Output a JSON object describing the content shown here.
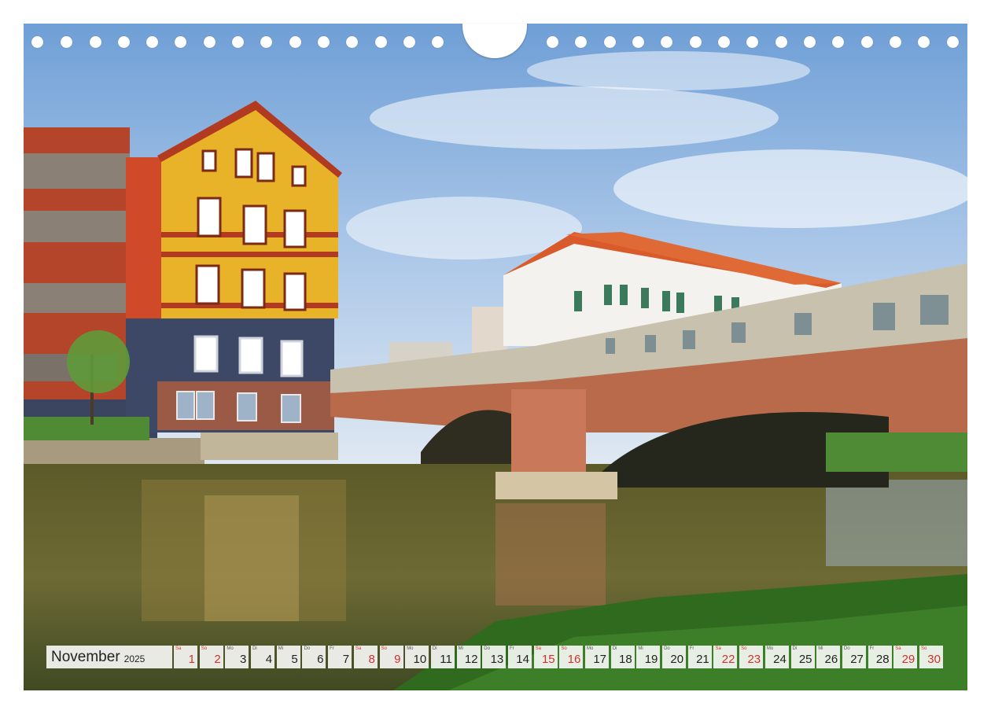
{
  "calendar": {
    "month": "November",
    "year": "2025",
    "days": [
      {
        "n": "1",
        "wd": "Sa",
        "we": true
      },
      {
        "n": "2",
        "wd": "So",
        "we": true
      },
      {
        "n": "3",
        "wd": "Mo",
        "we": false
      },
      {
        "n": "4",
        "wd": "Di",
        "we": false
      },
      {
        "n": "5",
        "wd": "Mi",
        "we": false
      },
      {
        "n": "6",
        "wd": "Do",
        "we": false
      },
      {
        "n": "7",
        "wd": "Fr",
        "we": false
      },
      {
        "n": "8",
        "wd": "Sa",
        "we": true
      },
      {
        "n": "9",
        "wd": "So",
        "we": true
      },
      {
        "n": "10",
        "wd": "Mo",
        "we": false
      },
      {
        "n": "11",
        "wd": "Di",
        "we": false
      },
      {
        "n": "12",
        "wd": "Mi",
        "we": false
      },
      {
        "n": "13",
        "wd": "Do",
        "we": false
      },
      {
        "n": "14",
        "wd": "Fr",
        "we": false
      },
      {
        "n": "15",
        "wd": "Sa",
        "we": true
      },
      {
        "n": "16",
        "wd": "So",
        "we": true
      },
      {
        "n": "17",
        "wd": "Mo",
        "we": false
      },
      {
        "n": "18",
        "wd": "Di",
        "we": false
      },
      {
        "n": "19",
        "wd": "Mi",
        "we": false
      },
      {
        "n": "20",
        "wd": "Do",
        "we": false
      },
      {
        "n": "21",
        "wd": "Fr",
        "we": false
      },
      {
        "n": "22",
        "wd": "Sa",
        "we": true
      },
      {
        "n": "23",
        "wd": "So",
        "we": true
      },
      {
        "n": "24",
        "wd": "Mo",
        "we": false
      },
      {
        "n": "25",
        "wd": "Di",
        "we": false
      },
      {
        "n": "26",
        "wd": "Mi",
        "we": false
      },
      {
        "n": "27",
        "wd": "Do",
        "we": false
      },
      {
        "n": "28",
        "wd": "Fr",
        "we": false
      },
      {
        "n": "29",
        "wd": "Sa",
        "we": true
      },
      {
        "n": "30",
        "wd": "So",
        "we": true
      }
    ]
  },
  "colors": {
    "weekend": "#d0312d",
    "text": "#222222"
  }
}
